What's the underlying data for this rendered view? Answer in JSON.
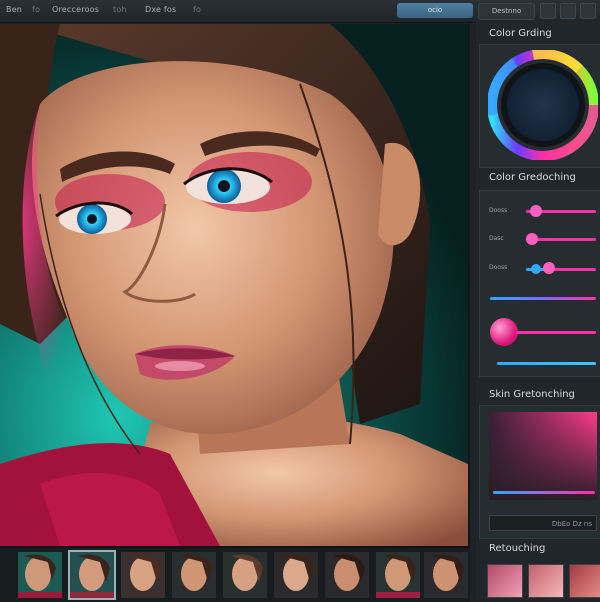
{
  "menu": {
    "items": [
      "Ben",
      "fo",
      "Orecceroos",
      "toh",
      "Dxe  fos",
      "fo"
    ]
  },
  "toolbar": {
    "primary_button": "ocio",
    "secondary_button": "Destnno"
  },
  "panel": {
    "color_grading_title": "Color Grding",
    "color_greding_title": "Color Gredoching",
    "slider_labels": [
      "Dooss",
      "Dasc",
      "Dooss"
    ],
    "skin_title": "Skin Gretonching",
    "input_value": "DbEo Dz ns",
    "retouching_title": "Retouching"
  },
  "colors": {
    "accent_pink": "#ff2fa8",
    "accent_blue": "#2fa8ff",
    "panel_bg": "#202629"
  },
  "filmstrip": {
    "count": 9,
    "selected_index": 1
  }
}
